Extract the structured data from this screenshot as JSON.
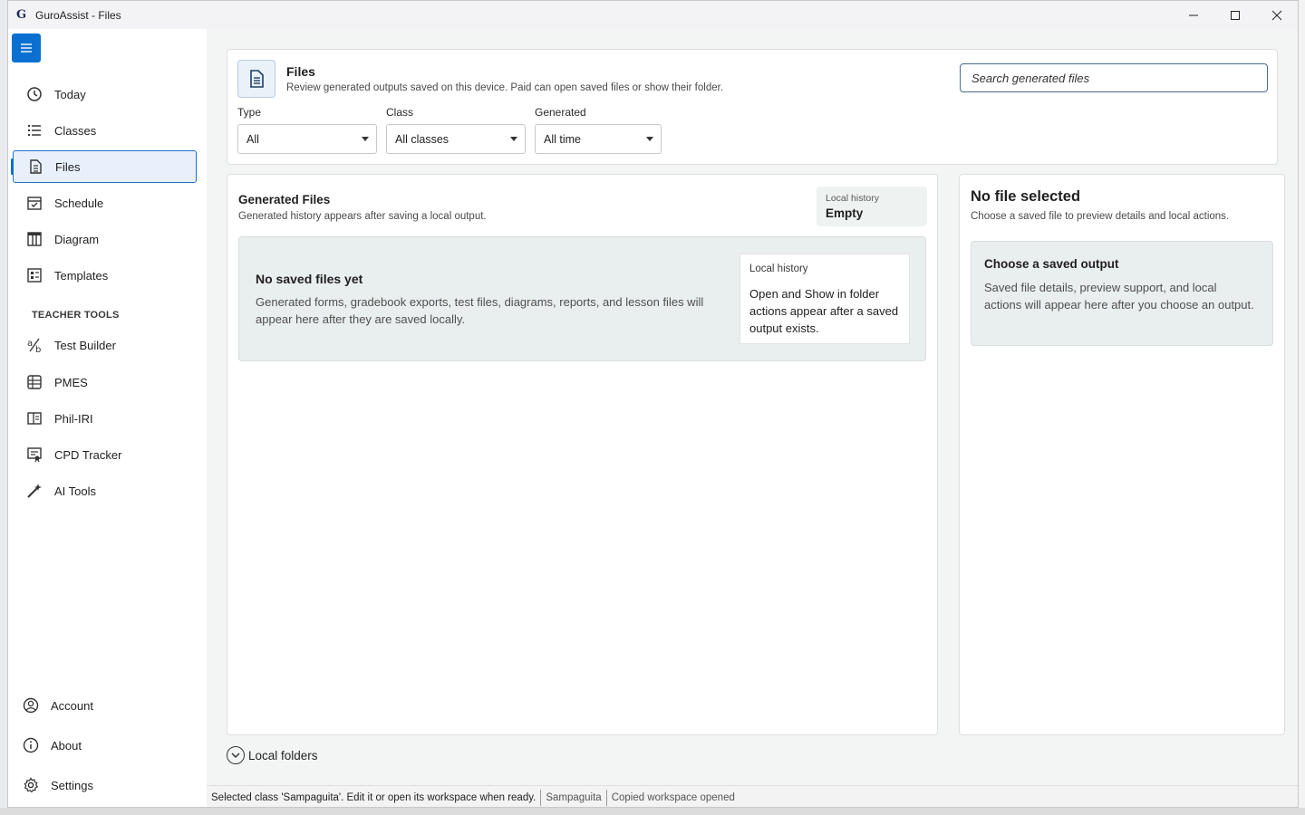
{
  "window": {
    "title": "GuroAssist - Files",
    "logo_text": "G"
  },
  "sidebar": {
    "items": [
      {
        "label": "Today",
        "icon": "clock-icon"
      },
      {
        "label": "Classes",
        "icon": "list-icon"
      },
      {
        "label": "Files",
        "icon": "document-icon",
        "active": true
      },
      {
        "label": "Schedule",
        "icon": "calendar-check-icon"
      },
      {
        "label": "Diagram",
        "icon": "table-layout-icon"
      },
      {
        "label": "Templates",
        "icon": "form-icon"
      }
    ],
    "section_label": "TEACHER TOOLS",
    "tools": [
      {
        "label": "Test Builder",
        "icon": "fraction-icon"
      },
      {
        "label": "PMES",
        "icon": "book-list-icon"
      },
      {
        "label": "Phil-IRI",
        "icon": "open-book-icon"
      },
      {
        "label": "CPD Tracker",
        "icon": "certificate-icon"
      },
      {
        "label": "AI Tools",
        "icon": "magic-wand-icon"
      }
    ],
    "footer": [
      {
        "label": "Account",
        "icon": "person-icon"
      },
      {
        "label": "About",
        "icon": "info-icon"
      },
      {
        "label": "Settings",
        "icon": "gear-icon"
      }
    ]
  },
  "header": {
    "title": "Files",
    "subtitle": "Review generated outputs saved on this device. Paid can open saved files or show their folder.",
    "search_placeholder": "Search generated files"
  },
  "filters": {
    "type": {
      "label": "Type",
      "value": "All"
    },
    "class": {
      "label": "Class",
      "value": "All classes"
    },
    "generated": {
      "label": "Generated",
      "value": "All time"
    }
  },
  "generated_files": {
    "title": "Generated Files",
    "subtitle": "Generated history appears after saving a local output.",
    "badge_label": "Local history",
    "badge_value": "Empty",
    "empty_title": "No saved files yet",
    "empty_text": "Generated forms, gradebook exports, test files, diagrams, reports, and lesson files will appear here after they are saved locally.",
    "card_label": "Local history",
    "card_text": "Open and Show in folder actions appear after a saved output exists."
  },
  "detail": {
    "title": "No file selected",
    "subtitle": "Choose a saved file to preview details and local actions.",
    "box_title": "Choose a saved output",
    "box_text": "Saved file details, preview support, and local actions will appear here after you choose an output."
  },
  "local_folders": "Local folders",
  "status": {
    "message": "Selected class 'Sampaguita'. Edit it or open its workspace when ready.",
    "class_name": "Sampaguita",
    "workspace": "Copied workspace opened"
  },
  "colors": {
    "accent": "#0a6fd1",
    "active_bg": "#e8f1fb",
    "panel_fill": "#e9efee",
    "main_bg": "#f3f5f4"
  }
}
